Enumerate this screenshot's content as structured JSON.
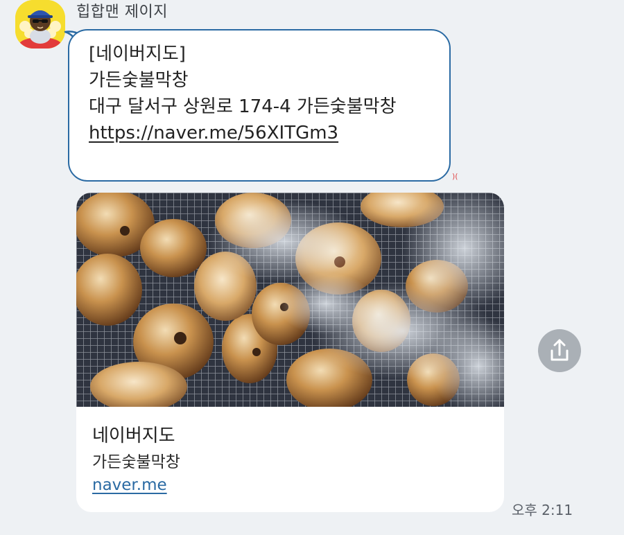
{
  "chat": {
    "sender_name": "힙합맨 제이지",
    "message": {
      "lines": [
        "[네이버지도]",
        "가든숯불막창",
        "대구 달서구 상원로 174-4 가든숯불막창"
      ],
      "link": "https://naver.me/56XITGm3"
    },
    "unread_mark": ")(",
    "preview": {
      "image": "grilled-makchang-photo",
      "title": "네이버지도",
      "description": "가든숯불막창",
      "domain": "naver.me"
    },
    "share_icon": "share-icon",
    "time": "오후 2:11"
  },
  "colors": {
    "background": "#eef1f4",
    "bubble_border": "#2a6aa3",
    "avatar_bg": "#f6dd2e",
    "link": "#2a6aa3",
    "share_button_bg": "#aab0b6",
    "unread": "#e04848"
  }
}
